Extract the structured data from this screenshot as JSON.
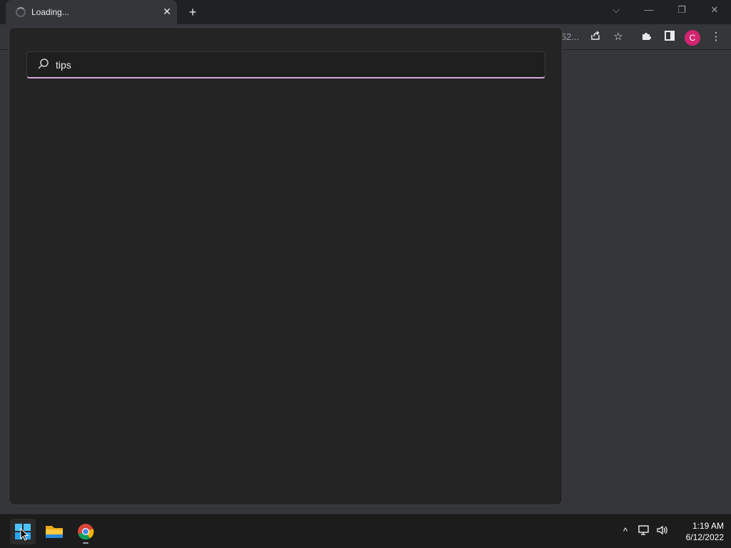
{
  "browser": {
    "tab_title": "Loading...",
    "tab_close": "✕",
    "new_tab": "+",
    "omnibox_truncated": "52...",
    "profile_initial": "C",
    "colors": {
      "profile_avatar": "#d2246f",
      "tabstrip": "#202124",
      "toolbar": "#35363a"
    }
  },
  "window_controls": {
    "tab_search": "⌵",
    "minimize": "—",
    "restore": "❐",
    "close": "✕"
  },
  "search": {
    "query": "tips",
    "colors": {
      "underline_accent": "#d6a8d9",
      "flyout_bg": "#242424"
    }
  },
  "taskbar": {
    "apps": [
      "start",
      "file-explorer",
      "chrome"
    ],
    "tray_chevron": "^",
    "time": "1:19 AM",
    "date": "6/12/2022"
  }
}
